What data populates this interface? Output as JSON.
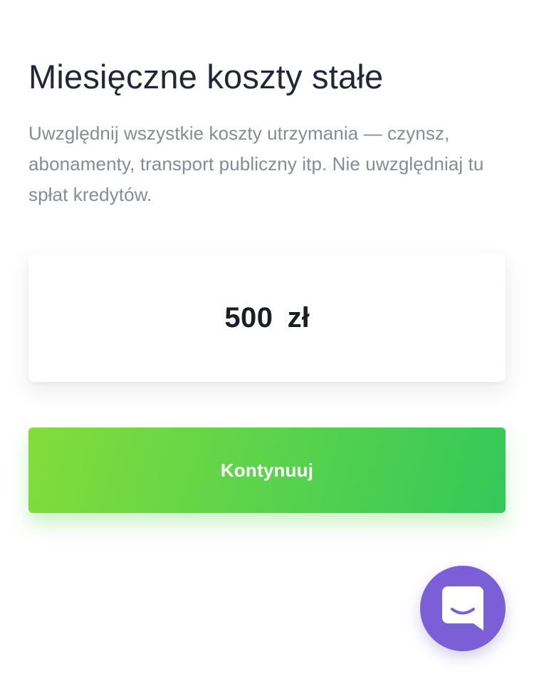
{
  "header": {
    "title": "Miesięczne koszty stałe",
    "description": "Uwzględnij wszystkie koszty utrzymania — czynsz, abonamenty, transport publiczny itp. Nie uwzględniaj tu spłat kredytów."
  },
  "amount_input": {
    "value": "500",
    "currency": "zł"
  },
  "actions": {
    "continue_label": "Kontynuuj"
  },
  "chat_widget": {
    "icon": "chat-bubble-icon",
    "color": "#7b5fd6"
  },
  "colors": {
    "button_gradient_start": "#84dc3a",
    "button_gradient_end": "#34c85a",
    "title": "#232633",
    "description": "#868b99"
  }
}
